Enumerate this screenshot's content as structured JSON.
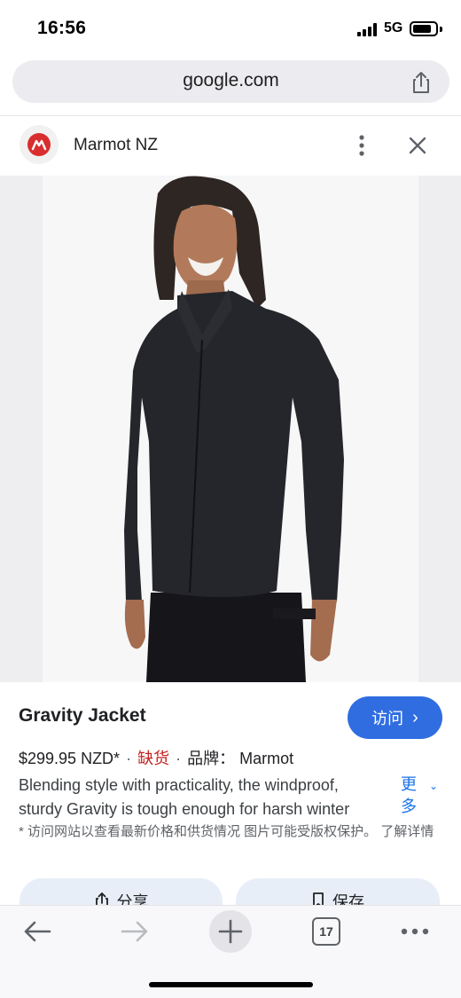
{
  "status_bar": {
    "time": "16:56",
    "network": "5G",
    "icons": [
      "signal-icon",
      "battery-icon"
    ]
  },
  "url_bar": {
    "domain": "google.com",
    "icons": [
      "share-icon"
    ]
  },
  "source": {
    "name": "Marmot NZ",
    "icons": [
      "marmot-logo-icon",
      "more-vert-icon",
      "close-icon"
    ]
  },
  "product": {
    "image_alt_icon": "product-photo",
    "title": "Gravity Jacket",
    "visit_label": "访问",
    "visit_chevron": "›",
    "price": "$299.95 NZD*",
    "separator": "·",
    "stock_status": "缺货",
    "brand_label": "品牌：",
    "brand": "Marmot",
    "description": "Blending style with practicality, the windproof, sturdy Gravity is tough enough for harsh winter",
    "more_label": "更多",
    "disclaimer": "* 访问网站以查看最新价格和供货情况 图片可能受版权保护。 了解详情"
  },
  "actions": {
    "share_label": "分享",
    "save_label": "保存"
  },
  "toolbar": {
    "tab_count": "17",
    "icons": [
      "back-arrow-icon",
      "forward-arrow-icon",
      "new-tab-plus-icon",
      "tabs-icon",
      "more-horiz-icon"
    ]
  },
  "colors": {
    "accent": "#2f6de1",
    "out_of_stock": "#c5221f",
    "link": "#1a73e8",
    "brand_red": "#d92e2e"
  }
}
